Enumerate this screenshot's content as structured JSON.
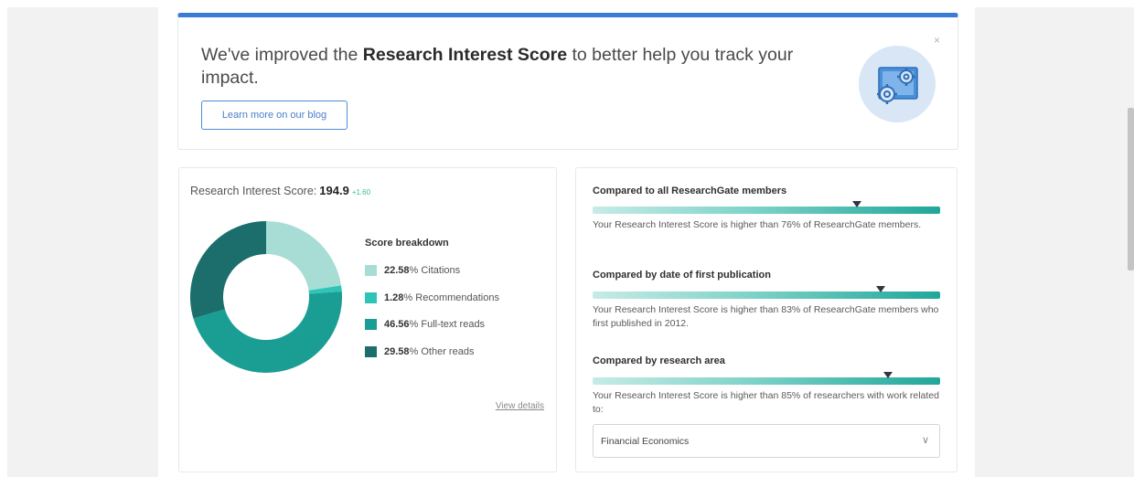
{
  "banner": {
    "text_before": "We've improved the ",
    "text_bold": "Research Interest Score",
    "text_after": " to better help you track your impact.",
    "learn_more_label": "Learn more on our blog",
    "close_label": "×"
  },
  "score_card": {
    "title": "Research Interest Score:",
    "score": "194.9",
    "delta": "+1.60",
    "breakdown_title": "Score breakdown",
    "items": [
      {
        "pct": "22.58",
        "label": "% Citations",
        "color": "#a8ddd6",
        "value": 22.58
      },
      {
        "pct": "1.28",
        "label": "% Recommendations",
        "color": "#2ec4b6",
        "value": 1.28
      },
      {
        "pct": "46.56",
        "label": "% Full-text reads",
        "color": "#1a9e93",
        "value": 46.56
      },
      {
        "pct": "29.58",
        "label": "% Other reads",
        "color": "#1b6e6c",
        "value": 29.58
      }
    ],
    "view_details": "View details"
  },
  "comparisons": [
    {
      "title": "Compared to all ResearchGate members",
      "text": "Your Research Interest Score is higher than 76% of ResearchGate members.",
      "percentile": 76
    },
    {
      "title": "Compared by date of first publication",
      "text": "Your Research Interest Score is higher than 83% of ResearchGate members who first published in 2012.",
      "percentile": 83
    },
    {
      "title": "Compared by research area",
      "text": "Your Research Interest Score is higher than 85% of researchers with work related to:",
      "percentile": 85
    }
  ],
  "research_area_select": {
    "value": "Financial Economics"
  }
}
